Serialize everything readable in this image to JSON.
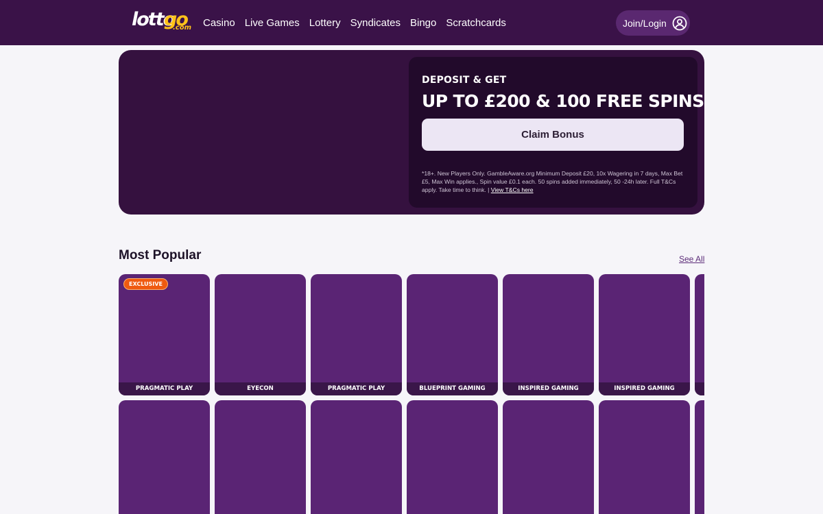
{
  "brand": {
    "logo_part1": "lotto",
    "logo_part2": "go",
    "logo_part3": ".com"
  },
  "nav": {
    "items": [
      {
        "label": "Casino"
      },
      {
        "label": "Live Games"
      },
      {
        "label": "Lottery"
      },
      {
        "label": "Syndicates"
      },
      {
        "label": "Bingo"
      },
      {
        "label": "Scratchcards"
      }
    ],
    "login_label": "Join/Login",
    "login_icon": "user-circle-icon"
  },
  "hero": {
    "kicker": "DEPOSIT & GET",
    "headline": "UP TO £200 & 100 FREE SPINS",
    "cta_label": "Claim Bonus",
    "terms": "*18+. New Players Only. GambleAware.org Minimum Deposit £20, 10x Wagering in 7 days, Max Bet £5, Max Win applies., Spin value £0.1 each. 50 spins added immediately, 50 -24h later. Full T&Cs apply. Take time to think. |",
    "terms_link": "View T&Cs here"
  },
  "most_popular": {
    "title": "Most Popular",
    "see_all": "See All",
    "row1": [
      {
        "provider": "PRAGMATIC PLAY",
        "badge": "EXCLUSIVE"
      },
      {
        "provider": "EYECON"
      },
      {
        "provider": "PRAGMATIC PLAY"
      },
      {
        "provider": "BLUEPRINT GAMING"
      },
      {
        "provider": "INSPIRED GAMING"
      },
      {
        "provider": "INSPIRED GAMING"
      },
      {
        "provider": ""
      }
    ],
    "row2_count": 7
  },
  "colors": {
    "header_bg": "#3a1248",
    "hero_bg": "#35113f",
    "promo_bg": "#220a2b",
    "card_bg": "#5a2474",
    "badge_bg": "#ef5a10",
    "logo_accent": "#ffc21a"
  }
}
